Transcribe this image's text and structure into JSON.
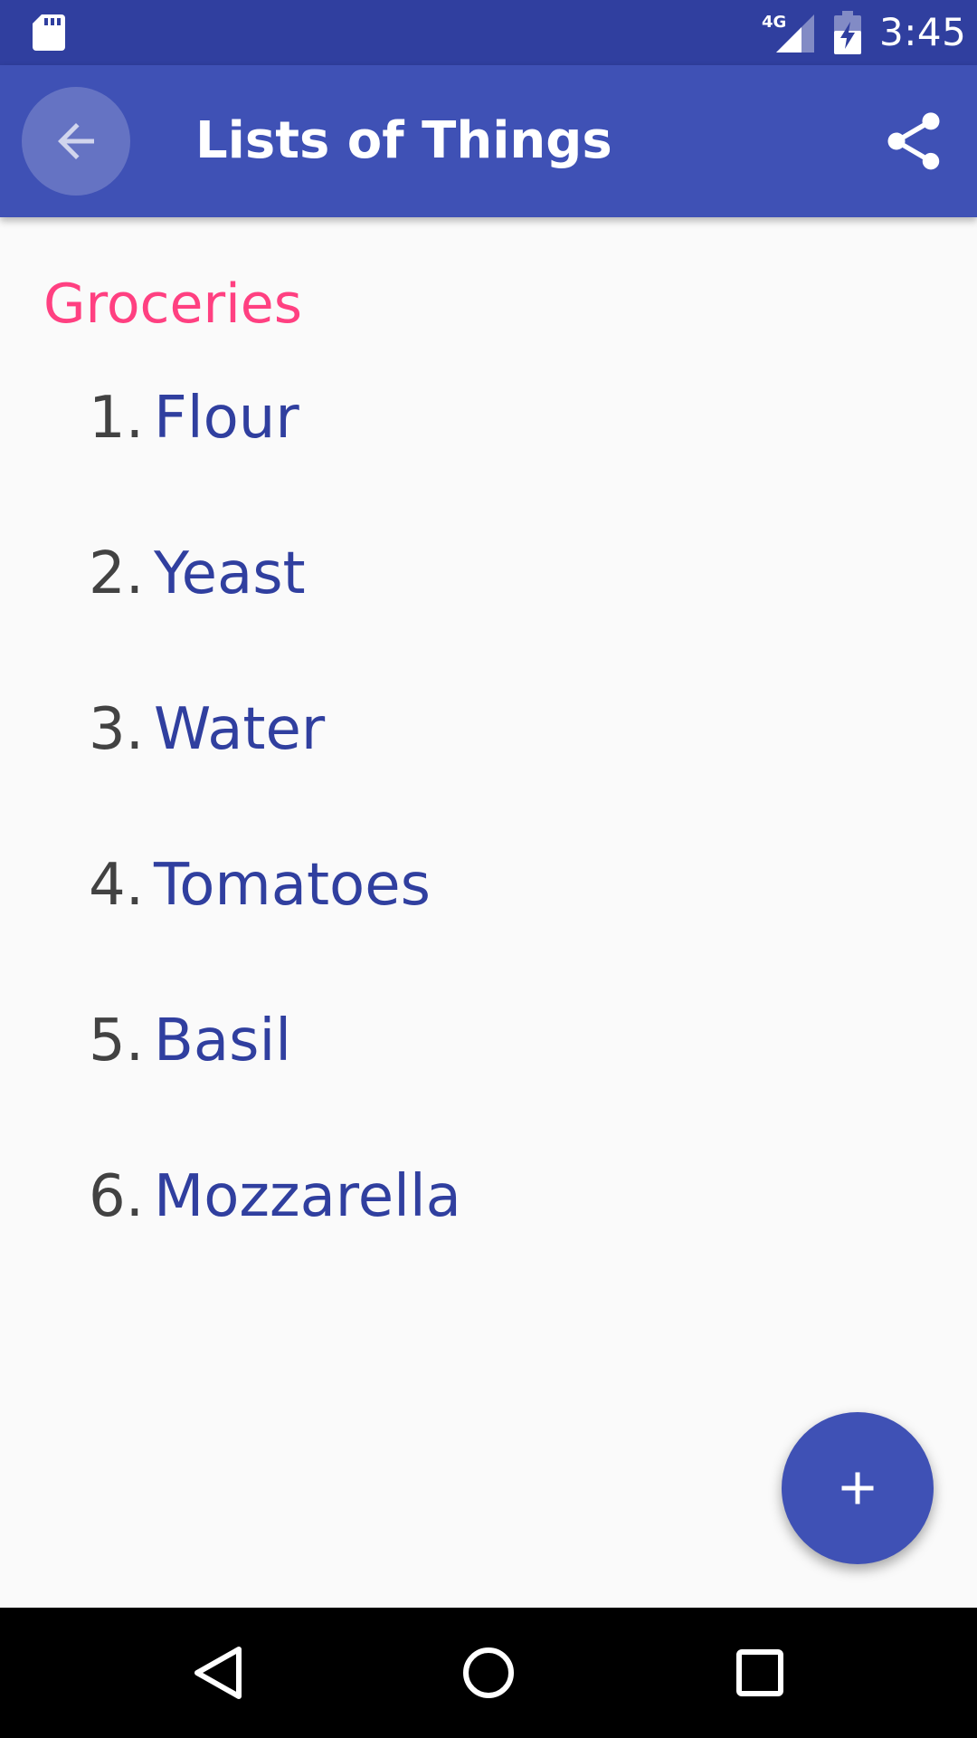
{
  "status_bar": {
    "time": "3:45",
    "network_label": "4G",
    "icons": [
      "sd-card-icon",
      "signal-icon",
      "battery-charging-icon"
    ]
  },
  "app_bar": {
    "title": "Lists of Things",
    "back_icon": "arrow-back-icon",
    "share_icon": "share-icon",
    "color": "#3f51b5"
  },
  "list": {
    "heading": "Groceries",
    "heading_color": "#ff4081",
    "items": [
      {
        "number": "1.",
        "label": "Flour"
      },
      {
        "number": "2.",
        "label": "Yeast"
      },
      {
        "number": "3.",
        "label": "Water"
      },
      {
        "number": "4.",
        "label": "Tomatoes"
      },
      {
        "number": "5.",
        "label": "Basil"
      },
      {
        "number": "6.",
        "label": "Mozzarella"
      }
    ]
  },
  "fab": {
    "icon": "plus-icon",
    "color": "#3f51b5"
  },
  "nav_bar": {
    "icons": [
      "nav-back-icon",
      "nav-home-icon",
      "nav-recents-icon"
    ]
  }
}
